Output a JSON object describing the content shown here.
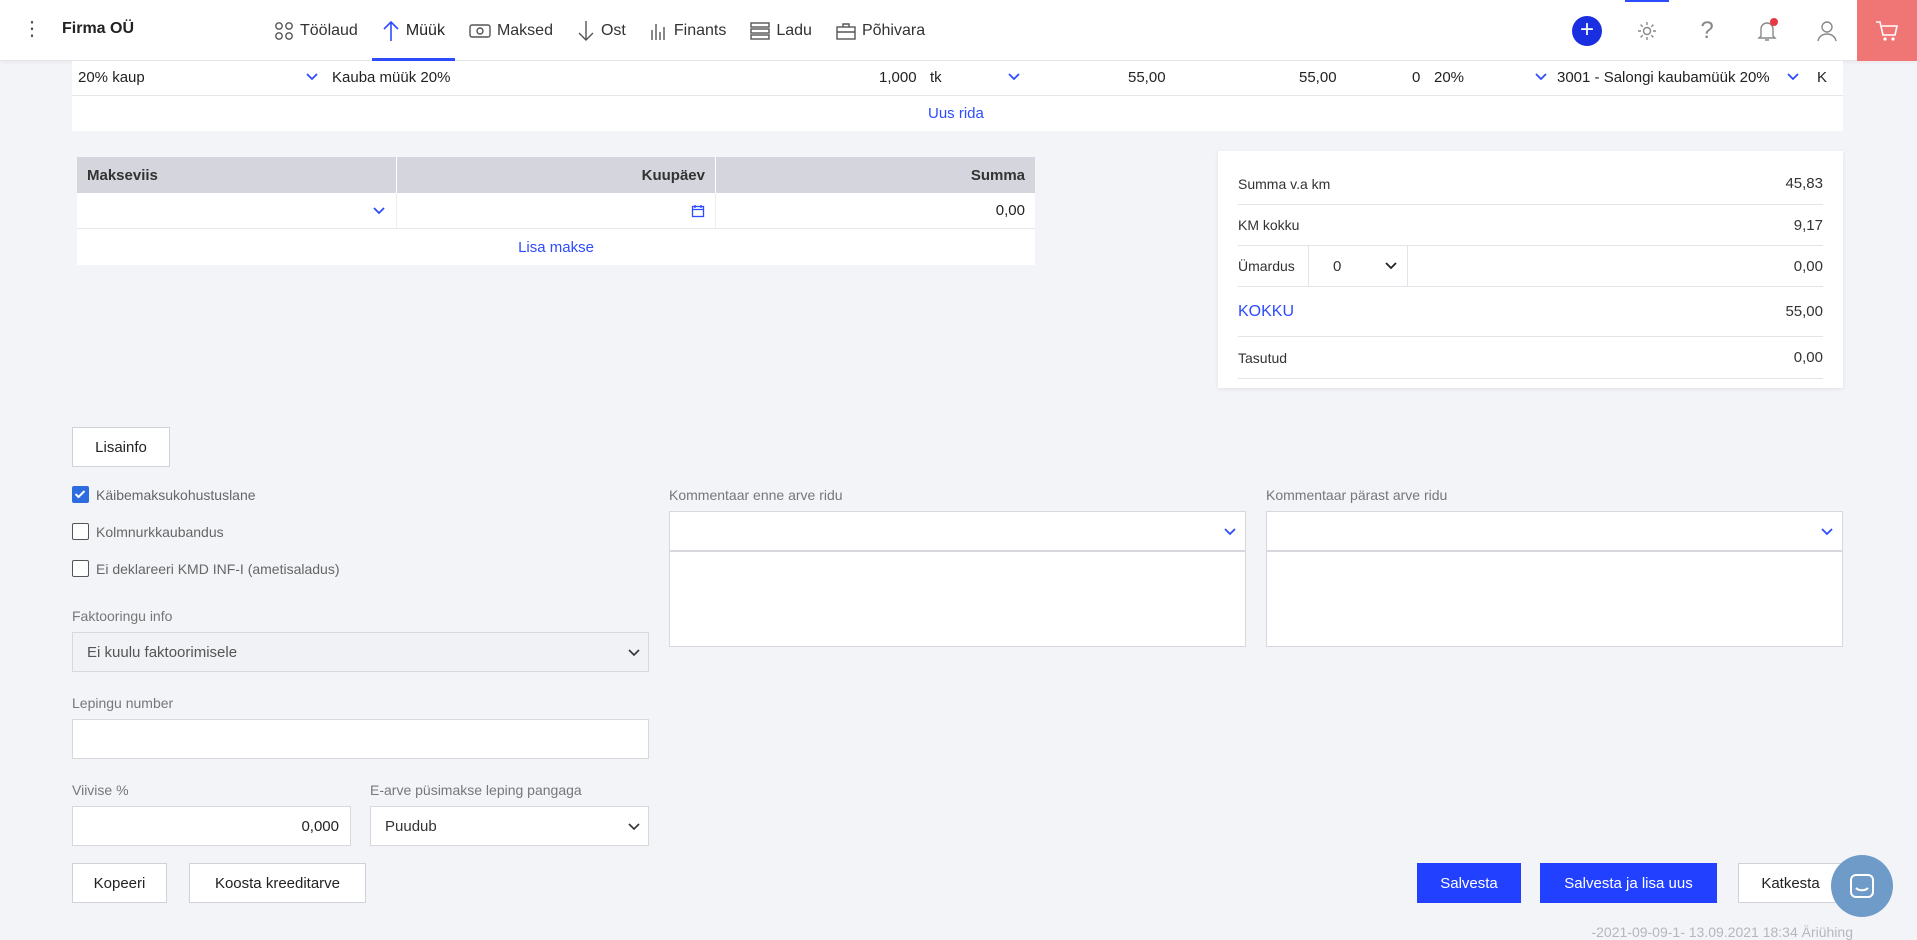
{
  "header": {
    "company": "Firma OÜ",
    "nav": [
      {
        "label": "Töölaud",
        "icon": "dashboard-icon"
      },
      {
        "label": "Müük",
        "icon": "arrow-up-icon"
      },
      {
        "label": "Maksed",
        "icon": "money-icon"
      },
      {
        "label": "Ost",
        "icon": "arrow-down-icon"
      },
      {
        "label": "Finants",
        "icon": "bar-chart-icon"
      },
      {
        "label": "Ladu",
        "icon": "stack-icon"
      },
      {
        "label": "Põhivara",
        "icon": "briefcase-icon"
      }
    ],
    "active_nav": "Müük"
  },
  "invoice_row": {
    "vat_type": "20% kaup",
    "description": "Kauba müük 20%",
    "quantity": "1,000",
    "unit": "tk",
    "price": "55,00",
    "sum": "55,00",
    "discount": "0",
    "vat": "20%",
    "account": "3001 - Salongi kaubamüük 20%",
    "extra": "K",
    "new_row_label": "Uus rida"
  },
  "payments": {
    "columns": [
      "Makseviis",
      "Kuupäev",
      "Summa"
    ],
    "row_sum": "0,00",
    "add_label": "Lisa makse"
  },
  "totals": {
    "rows": [
      {
        "label": "Summa v.a km",
        "value": "45,83"
      },
      {
        "label": "KM kokku",
        "value": "9,17"
      }
    ],
    "rounding_label": "Ümardus",
    "rounding_select": "0",
    "rounding_value": "0,00",
    "total_label": "KOKKU",
    "total_value": "55,00",
    "paid_label": "Tasutud",
    "paid_value": "0,00"
  },
  "lisainfo_button": "Lisainfo",
  "checkboxes": [
    {
      "label": "Käibemaksukohustuslane",
      "checked": true
    },
    {
      "label": "Kolmnurkkaubandus",
      "checked": false
    },
    {
      "label": "Ei deklareeri KMD INF-I (ametisaladus)",
      "checked": false
    }
  ],
  "factoring": {
    "label": "Faktooringu info",
    "value": "Ei kuulu faktoorimisele"
  },
  "contract": {
    "label": "Lepingu number",
    "value": ""
  },
  "penalty": {
    "label": "Viivise %",
    "value": "0,000"
  },
  "einvoice": {
    "label": "E-arve püsimakse leping pangaga",
    "value": "Puudub"
  },
  "comment_before": {
    "label": "Kommentaar enne arve ridu"
  },
  "comment_after": {
    "label": "Kommentaar pärast arve ridu"
  },
  "buttons": {
    "copy": "Kopeeri",
    "credit": "Koosta kreeditarve",
    "save": "Salvesta",
    "save_new": "Salvesta ja lisa uus",
    "cancel": "Katkesta"
  },
  "footer": "-2021-09-09-1- 13.09.2021 18:34 Äriühing"
}
